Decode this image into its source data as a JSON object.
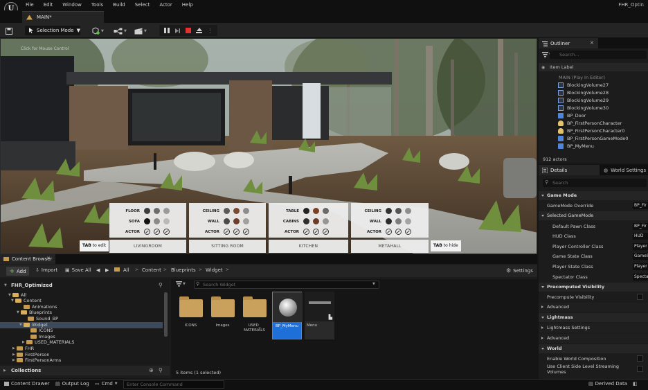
{
  "app": {
    "logo": "U",
    "project_name": "FHR_Optin"
  },
  "menu": [
    "File",
    "Edit",
    "Window",
    "Tools",
    "Build",
    "Select",
    "Actor",
    "Help"
  ],
  "level_tab": {
    "label": "MAIN*"
  },
  "toolbar": {
    "selection_mode": "Selection Mode"
  },
  "viewport": {
    "hint": "Click for Mouse Control",
    "panels": [
      {
        "rows": [
          {
            "label": "FLOOR",
            "swatches": [
              "#3c3c3c",
              "#6d6d6d",
              "#9a9a9a"
            ]
          },
          {
            "label": "SOFA",
            "swatches": [
              "#111111",
              "#8a8a8a",
              "#b9b9b9"
            ]
          },
          {
            "label": "ACTOR"
          }
        ],
        "tab": "LIVINGROOM"
      },
      {
        "rows": [
          {
            "label": "CEILING",
            "swatches": [
              "#5a5a5a",
              "#7a4a32",
              "#8d8d8d"
            ]
          },
          {
            "label": "WALL",
            "swatches": [
              "#4a4a4a",
              "#6e3d2a",
              "#a0a0a0"
            ]
          },
          {
            "label": "ACTOR"
          }
        ],
        "tab": "SITTING ROOM"
      },
      {
        "rows": [
          {
            "label": "TABLE",
            "swatches": [
              "#222222",
              "#7a4125",
              "#6a6a6a"
            ]
          },
          {
            "label": "CABINS",
            "swatches": [
              "#2e2e2e",
              "#6b3b27",
              "#969696"
            ]
          },
          {
            "label": "ACTOR"
          }
        ],
        "tab": "KITCHEN"
      },
      {
        "rows": [
          {
            "label": "CEILING",
            "swatches": [
              "#333333",
              "#555555",
              "#8e8e8e"
            ]
          },
          {
            "label": "WALL",
            "swatches": [
              "#2b2b2b",
              "#7e7e7e",
              "#a5a5a5"
            ]
          },
          {
            "label": "ACTOR"
          }
        ],
        "tab": "METAHALL"
      }
    ],
    "tab_edit": {
      "key": "TAB",
      "text": "to edit"
    },
    "tab_hide": {
      "key": "TAB",
      "text": "to hide"
    }
  },
  "outliner": {
    "title": "Outliner",
    "search_placeholder": "Search...",
    "column": "Item Label",
    "items": [
      {
        "label": "MAIN (Play In Editor)",
        "icon": ""
      },
      {
        "label": "BlockingVolume27",
        "icon": "volume"
      },
      {
        "label": "BlockingVolume28",
        "icon": "volume"
      },
      {
        "label": "BlockingVolume29",
        "icon": "volume"
      },
      {
        "label": "BlockingVolume30",
        "icon": "volume"
      },
      {
        "label": "BP_Door",
        "icon": "bp"
      },
      {
        "label": "BP_FirstPersonCharacter",
        "icon": "char"
      },
      {
        "label": "BP_FirstPersonCharacter0",
        "icon": "char"
      },
      {
        "label": "BP_FirstPersonGameMode0",
        "icon": "bp"
      },
      {
        "label": "BP_MyMenu",
        "icon": "bp"
      }
    ],
    "actor_count": "912 actors"
  },
  "details": {
    "tab": "Details",
    "world_tab": "World Settings",
    "search_placeholder": "Search",
    "game_mode_section": "Game Mode",
    "gamemode_override": {
      "label": "GameMode Override",
      "value": "BP_Fir"
    },
    "selected_gamemode": "Selected GameMode",
    "props": [
      {
        "label": "Default Pawn Class",
        "value": "BP_Fir"
      },
      {
        "label": "HUD Class",
        "value": "HUD"
      },
      {
        "label": "Player Controller Class",
        "value": "Player"
      },
      {
        "label": "Game State Class",
        "value": "GameS"
      },
      {
        "label": "Player State Class",
        "value": "Player"
      },
      {
        "label": "Spectator Class",
        "value": "Specta"
      }
    ],
    "precomputed_section": "Precomputed Visibility",
    "precompute_visibility": "Precompute Visibility",
    "advanced": "Advanced",
    "lightmass_section": "Lightmass",
    "lightmass_settings": "Lightmass Settings",
    "advanced2": "Advanced",
    "world_section": "World",
    "enable_world_composition": "Enable World Composition",
    "use_client_streaming": "Use Client Side Level Streaming Volumes"
  },
  "content_browser": {
    "tab": "Content Browser",
    "add": "Add",
    "import": "Import",
    "save_all": "Save All",
    "breadcrumb": [
      "All",
      "Content",
      "Blueprints",
      "Widget"
    ],
    "settings": "Settings",
    "root": "FHR_Optimized",
    "tree": [
      "All",
      "Content",
      "Animations",
      "Blueprints",
      "Sound_BP",
      "Widget",
      "ICONS",
      "Images",
      "USED_MATERIALS",
      "FHR",
      "FirstPerson",
      "FirstPersonArms"
    ],
    "search_placeholder": "Search Widget",
    "assets": [
      {
        "label": "ICONS",
        "kind": "folder"
      },
      {
        "label": "Images",
        "kind": "folder"
      },
      {
        "label": "USED_ MATERIALS",
        "kind": "folder"
      },
      {
        "label": "BP_MyMenu",
        "kind": "blueprint"
      },
      {
        "label": "Menu",
        "kind": "widget"
      }
    ],
    "items_count": "5 items (1 selected)",
    "collections": "Collections"
  },
  "statusbar": {
    "content_drawer": "Content Drawer",
    "output_log": "Output Log",
    "cmd": "Cmd",
    "console_placeholder": "Enter Console Command",
    "derived_data": "Derived Data"
  }
}
